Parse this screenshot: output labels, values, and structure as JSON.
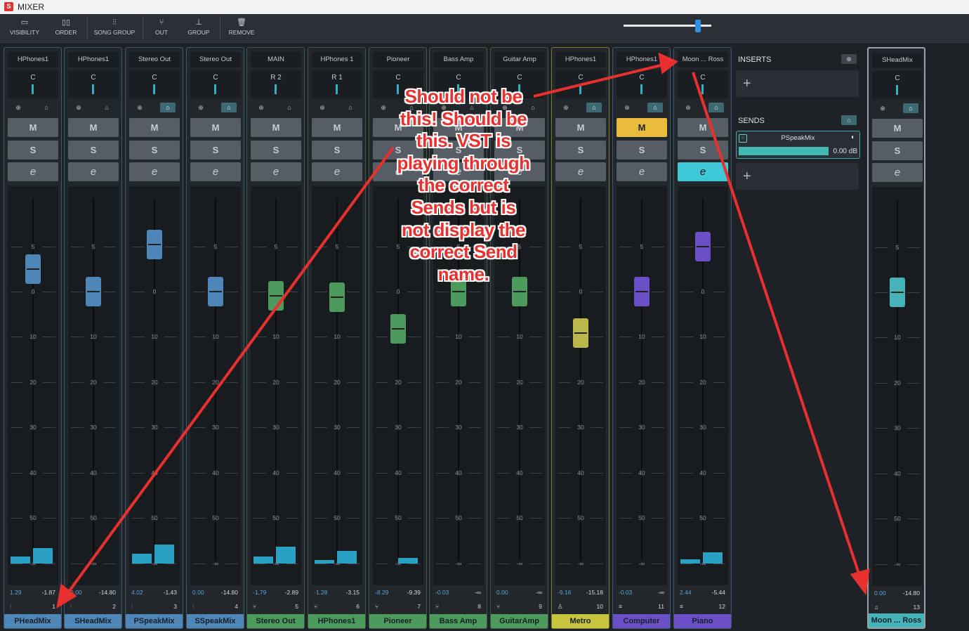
{
  "window": {
    "title": "MIXER",
    "logo_text": "S"
  },
  "toolbar": {
    "visibility": "VISIBILITY",
    "order": "ORDER",
    "song_group": "SONG GROUP",
    "out": "OUT",
    "group": "GROUP",
    "remove": "REMOVE"
  },
  "zoom_level": 0.85,
  "scale": {
    "labels": [
      "5",
      "0",
      "10",
      "20",
      "30",
      "40",
      "50",
      "-∞"
    ]
  },
  "channels": [
    {
      "output": "HPhones1",
      "pan": "C",
      "level": "1.29",
      "peak": "-1.87",
      "index": "1",
      "name": "PHeadMix",
      "fader_db": 2.5,
      "mute_on": false,
      "monitor_on": false,
      "color": "#4f86b8"
    },
    {
      "output": "HPhones1",
      "pan": "C",
      "level": "0.00",
      "peak": "-14.80",
      "index": "2",
      "name": "SHeadMix",
      "fader_db": 0,
      "mute_on": false,
      "monitor_on": false,
      "color": "#4f86b8"
    },
    {
      "output": "Stereo Out",
      "pan": "C",
      "level": "4.02",
      "peak": "-1.43",
      "index": "3",
      "name": "PSpeakMix",
      "fader_db": 5.2,
      "mute_on": false,
      "monitor_on": true,
      "color": "#4f86b8"
    },
    {
      "output": "Stereo Out",
      "pan": "C",
      "level": "0.00",
      "peak": "-14.80",
      "index": "4",
      "name": "SSpeakMix",
      "fader_db": 0,
      "mute_on": false,
      "monitor_on": true,
      "color": "#4f86b8"
    },
    {
      "output": "MAIN",
      "pan": "R 2",
      "level": "-1.79",
      "peak": "-2.89",
      "index": "5",
      "name": "Stereo Out",
      "fader_db": -1.0,
      "mute_on": false,
      "monitor_on": false,
      "color": "#4d9a5d"
    },
    {
      "output": "HPhones 1",
      "pan": "R 1",
      "level": "-1.28",
      "peak": "-3.15",
      "index": "6",
      "name": "HPhones1",
      "fader_db": -1.2,
      "mute_on": false,
      "monitor_on": false,
      "color": "#4d9a5d"
    },
    {
      "output": "Pioneer",
      "pan": "C",
      "level": "-8.29",
      "peak": "-9.39",
      "index": "7",
      "name": "Pioneer",
      "fader_db": -8.3,
      "mute_on": false,
      "monitor_on": false,
      "color": "#4d9a5d"
    },
    {
      "output": "Bass Amp",
      "pan": "C",
      "level": "-0.03",
      "peak": "-∞",
      "index": "8",
      "name": "Bass Amp",
      "fader_db": 0,
      "mute_on": false,
      "monitor_on": false,
      "color": "#4d9a5d"
    },
    {
      "output": "Guitar Amp",
      "pan": "C",
      "level": "0.00",
      "peak": "-∞",
      "index": "9",
      "name": "GuitarAmp",
      "fader_db": 0,
      "mute_on": false,
      "monitor_on": false,
      "color": "#4d9a5d"
    },
    {
      "output": "HPhones1",
      "pan": "C",
      "level": "-9.16",
      "peak": "-15.18",
      "index": "10",
      "name": "Metro",
      "fader_db": -9.2,
      "mute_on": false,
      "monitor_on": true,
      "color": "#c8c43e"
    },
    {
      "output": "HPhones1",
      "pan": "C",
      "level": "-0.03",
      "peak": "-∞",
      "index": "11",
      "name": "Computer",
      "fader_db": 0,
      "mute_on": true,
      "monitor_on": true,
      "color": "#6b4fc6"
    },
    {
      "output": "Moon ... Ross",
      "pan": "C",
      "level": "2.44",
      "peak": "-5.44",
      "index": "12",
      "name": "Piano",
      "fader_db": 5.0,
      "mute_on": false,
      "monitor_on": true,
      "color": "#6b4fc6"
    },
    {
      "output": "SHeadMix",
      "pan": "C",
      "level": "0.00",
      "peak": "-14.80",
      "index": "13",
      "name": "Moon ... Ross",
      "fader_db": 0,
      "mute_on": false,
      "monitor_on": true,
      "color": "#45b3b8"
    }
  ],
  "button_labels": {
    "mute": "M",
    "solo": "S",
    "edit": "e"
  },
  "panel": {
    "inserts_title": "INSERTS",
    "sends_title": "SENDS",
    "send_name": "PSpeakMix",
    "send_value": "0.00 dB",
    "send_level": 0.75,
    "add": "+"
  },
  "annotation": {
    "lines": [
      "Should not be",
      "this! Should be",
      "this. VST is",
      "playing through",
      "the correct",
      "Sends but is",
      "not display the",
      "correct Send",
      "name."
    ]
  }
}
